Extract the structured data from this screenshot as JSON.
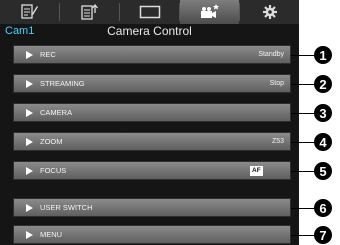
{
  "tabs": [
    {
      "icon": "document-edit-icon"
    },
    {
      "icon": "document-export-icon"
    },
    {
      "icon": "screen-icon"
    },
    {
      "icon": "camera-settings-icon",
      "active": true
    },
    {
      "icon": "gear-icon"
    }
  ],
  "header": {
    "camera_name": "Cam1",
    "title": "Camera Control"
  },
  "menu_items": [
    {
      "label": "REC",
      "value": "Standby",
      "callout": "1"
    },
    {
      "label": "STREAMING",
      "value": "Stop",
      "callout": "2"
    },
    {
      "label": "CAMERA",
      "value": "",
      "callout": "3"
    },
    {
      "label": "ZOOM",
      "value": "Z53",
      "callout": "4"
    },
    {
      "label": "FOCUS",
      "badge": "AF",
      "callout": "5"
    },
    {
      "label": "USER SWITCH",
      "value": "",
      "callout": "6"
    },
    {
      "label": "MENU",
      "value": "",
      "callout": "7"
    }
  ],
  "colors": {
    "accent": "#48d0ff",
    "background": "#151515",
    "row": "#7a7a7a"
  }
}
